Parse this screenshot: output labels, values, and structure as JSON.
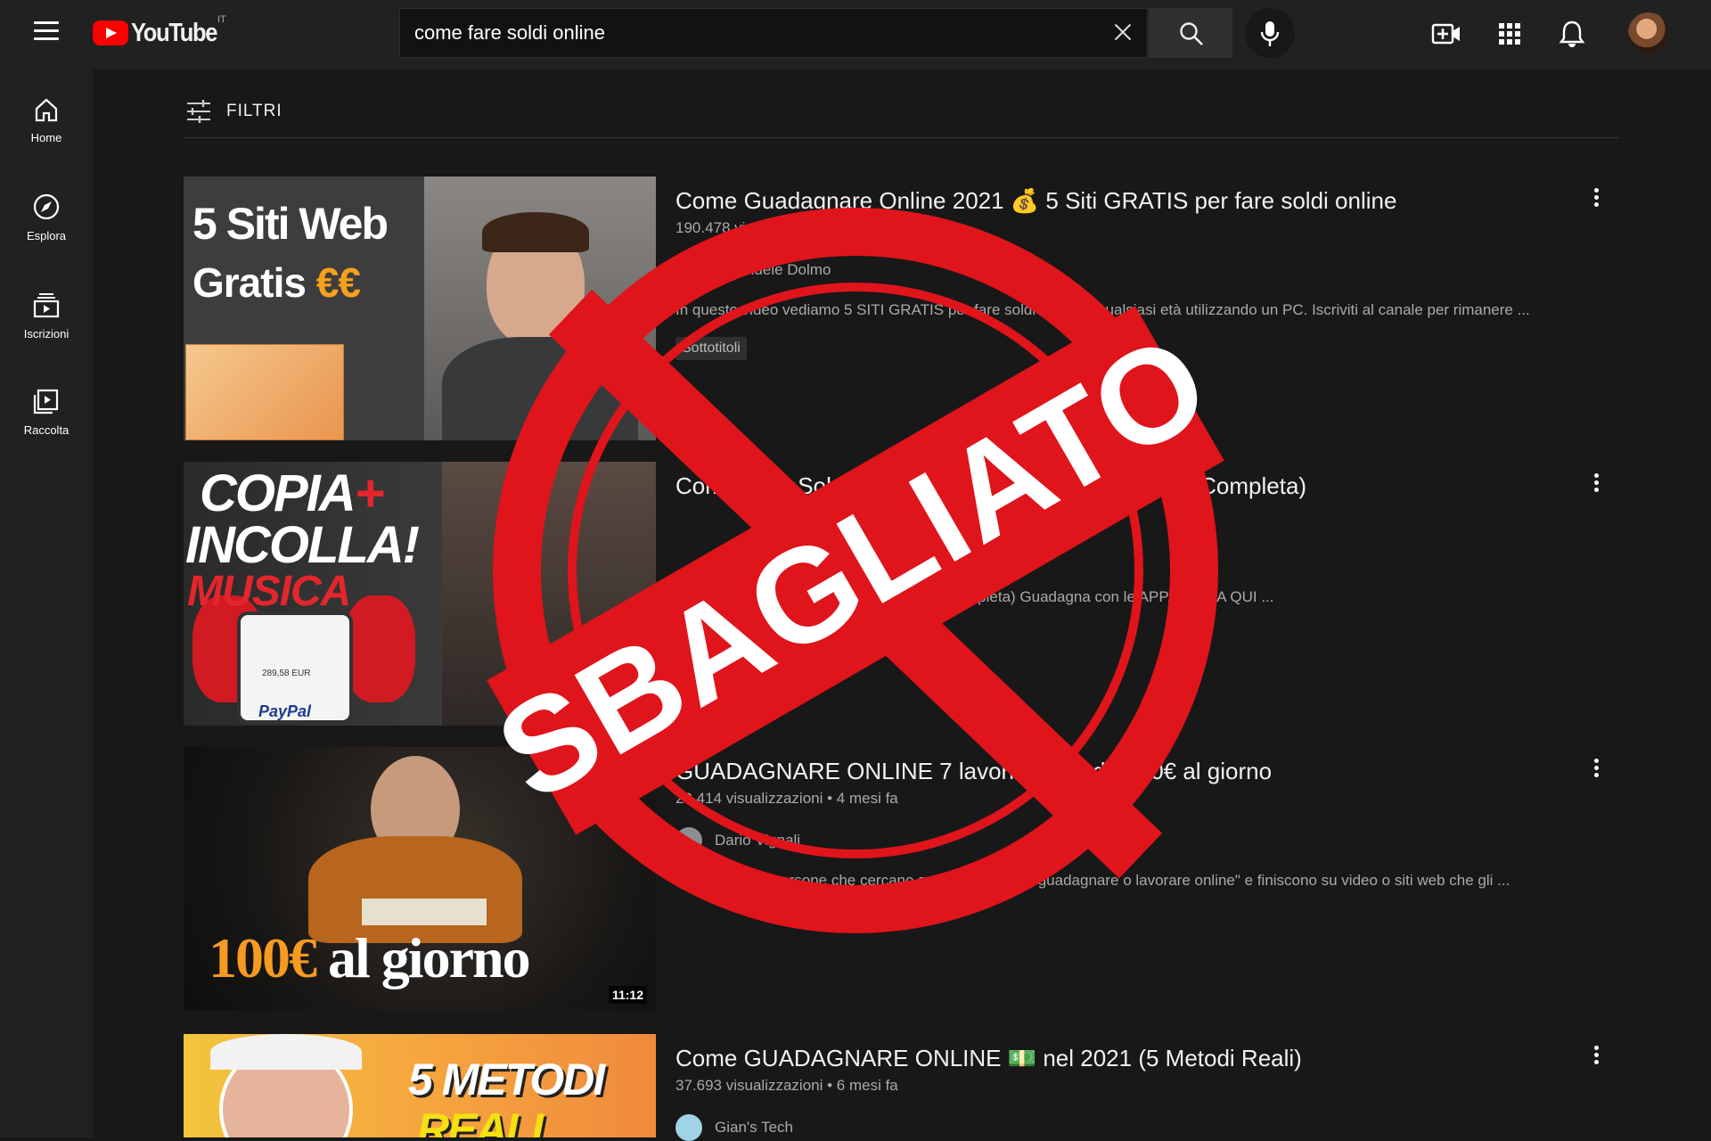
{
  "header": {
    "logo_text": "YouTube",
    "country_code": "IT",
    "search_value": "come fare soldi online"
  },
  "sidebar": {
    "items": [
      {
        "label": "Home",
        "icon": "home-icon"
      },
      {
        "label": "Esplora",
        "icon": "compass-icon"
      },
      {
        "label": "Iscrizioni",
        "icon": "subscriptions-icon"
      },
      {
        "label": "Raccolta",
        "icon": "library-icon"
      }
    ]
  },
  "filters_label": "FILTRI",
  "videos": [
    {
      "title": "Come Guadagnare Online 2021 💰 5 Siti GRATIS per fare soldi online",
      "meta": "190.478 visualizzazioni • 1 anno fa",
      "channel": "Emanuele Dolmo",
      "description": "In questo video vediamo 5 SITI GRATIS per fare soldi online a qualsiasi età utilizzando un PC. Iscriviti al canale per rimanere ...",
      "badge": "Sottotitoli",
      "thumb_lines": [
        "5 Siti Web",
        "Gratis",
        "€€"
      ],
      "duration": ""
    },
    {
      "title": "Come Fare Soldi Online con la MUSICA (Strategia Completa)",
      "meta": "",
      "channel": "",
      "description": "COPIA E INCOLLA MUSICA! (Strategia Completa) Guadagna con le APP.CLICCA QUI ...",
      "thumb_lines": [
        "COPIA",
        "+",
        "INCOLLA!",
        "MUSICA"
      ],
      "paypal_text": "PayPal",
      "paypal_balance": "289,58 EUR"
    },
    {
      "title": "GUADAGNARE ONLINE  7 lavori digitali da 100€ al giorno",
      "meta": "29.414 visualizzazioni • 4 mesi fa",
      "channel": "Dario Vignali",
      "description": "Sono molte le persone che cercano su Google \"come guadagnare o lavorare online\" e finiscono su video o siti web che gli ...",
      "thumb_lines": [
        "100€",
        "al giorno"
      ],
      "duration": "11:12"
    },
    {
      "title": "Come GUADAGNARE ONLINE 💵 nel 2021 (5 Metodi Reali)",
      "meta": "37.693 visualizzazioni • 6 mesi fa",
      "channel": "Gian's Tech",
      "thumb_lines": [
        "5 METODI",
        "REALI"
      ]
    }
  ],
  "stamp_text": "SBAGLIATO",
  "colors": {
    "stamp_red": "#e0141b",
    "youtube_red": "#ff0000",
    "bg": "#181818"
  }
}
